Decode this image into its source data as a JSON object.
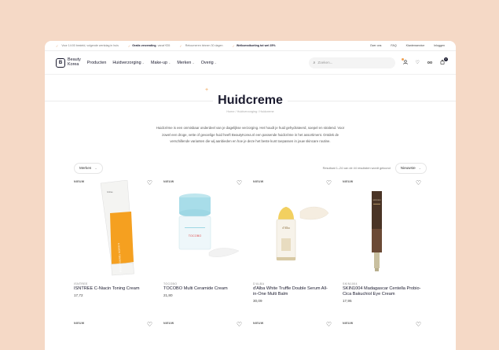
{
  "topbar": {
    "usps": [
      {
        "bold": "",
        "text": "Voor 14:00 besteld, volgende werkdag in huis"
      },
      {
        "bold": "Gratis verzending",
        "text": "vanaf €35"
      },
      {
        "bold": "",
        "text": "Retourneren binnen 30 dagen"
      },
      {
        "bold": "Welkomstkorting tot wel 25%",
        "text": ""
      }
    ],
    "links": [
      "Over ons",
      "FAQ",
      "Klantenservice",
      "Inloggen"
    ]
  },
  "header": {
    "logo_mark": "B",
    "logo_line1": "Beauty",
    "logo_line2": "Korea",
    "nav": [
      "Producten",
      "Huidverzorging",
      "Make-up",
      "Merken",
      "Overig"
    ],
    "search_placeholder": "Zoeken...",
    "cart_count": "0"
  },
  "page": {
    "title": "Huidcreme",
    "breadcrumb": "Home  /  Huidverzorging  /  Huidcreme",
    "intro": "Huidcrème is een onmisbaar onderdeel van je dagelijkse verzorging. Het houdt je huid gehydrateerd, soepel en stralend. Voor zowel een droge, vette of gevoelige huid heeft BeautyKorea.nl een passende huidcrème in het assortiment. Ontdek de verschillende varianten die wij aanbieden en hoe je deze het beste kunt toepassen in jouw skincare routine."
  },
  "filters": {
    "brand_filter": "Merken",
    "results": "Resultaat 1–24 van de 44 resultaten wordt getoond",
    "sort": "Nieuwste"
  },
  "products": [
    {
      "badge": "NIEUW",
      "brand": "ISNTREE",
      "name": "ISNTREE C-Niacin Toning Cream",
      "price": "17,72"
    },
    {
      "badge": "NIEUW",
      "brand": "TOCOBO",
      "name": "TOCOBO Multi Ceramide Cream",
      "price": "21,80"
    },
    {
      "badge": "NIEUW",
      "brand": "D'ALBA",
      "name": "d'Alba White Truffle Double Serum All-in-One Multi Balm",
      "price": "30,09"
    },
    {
      "badge": "NIEUW",
      "brand": "SKIN1004",
      "name": "SKIN1004 Madagascar Centella Probio-Cica Bakuchiol Eye Cream",
      "price": "17,95"
    }
  ],
  "row2_badges": [
    "NIEUW",
    "NIEUW",
    "NIEUW",
    "NIEUW"
  ],
  "colors": {
    "background": "#f5d9c6",
    "accent": "#f0a050",
    "text": "#1a1a2e"
  },
  "icons": {
    "search": "search-icon",
    "user": "user-icon",
    "wishlist": "heart-icon",
    "compare": "compare-icon",
    "cart": "bag-icon"
  }
}
